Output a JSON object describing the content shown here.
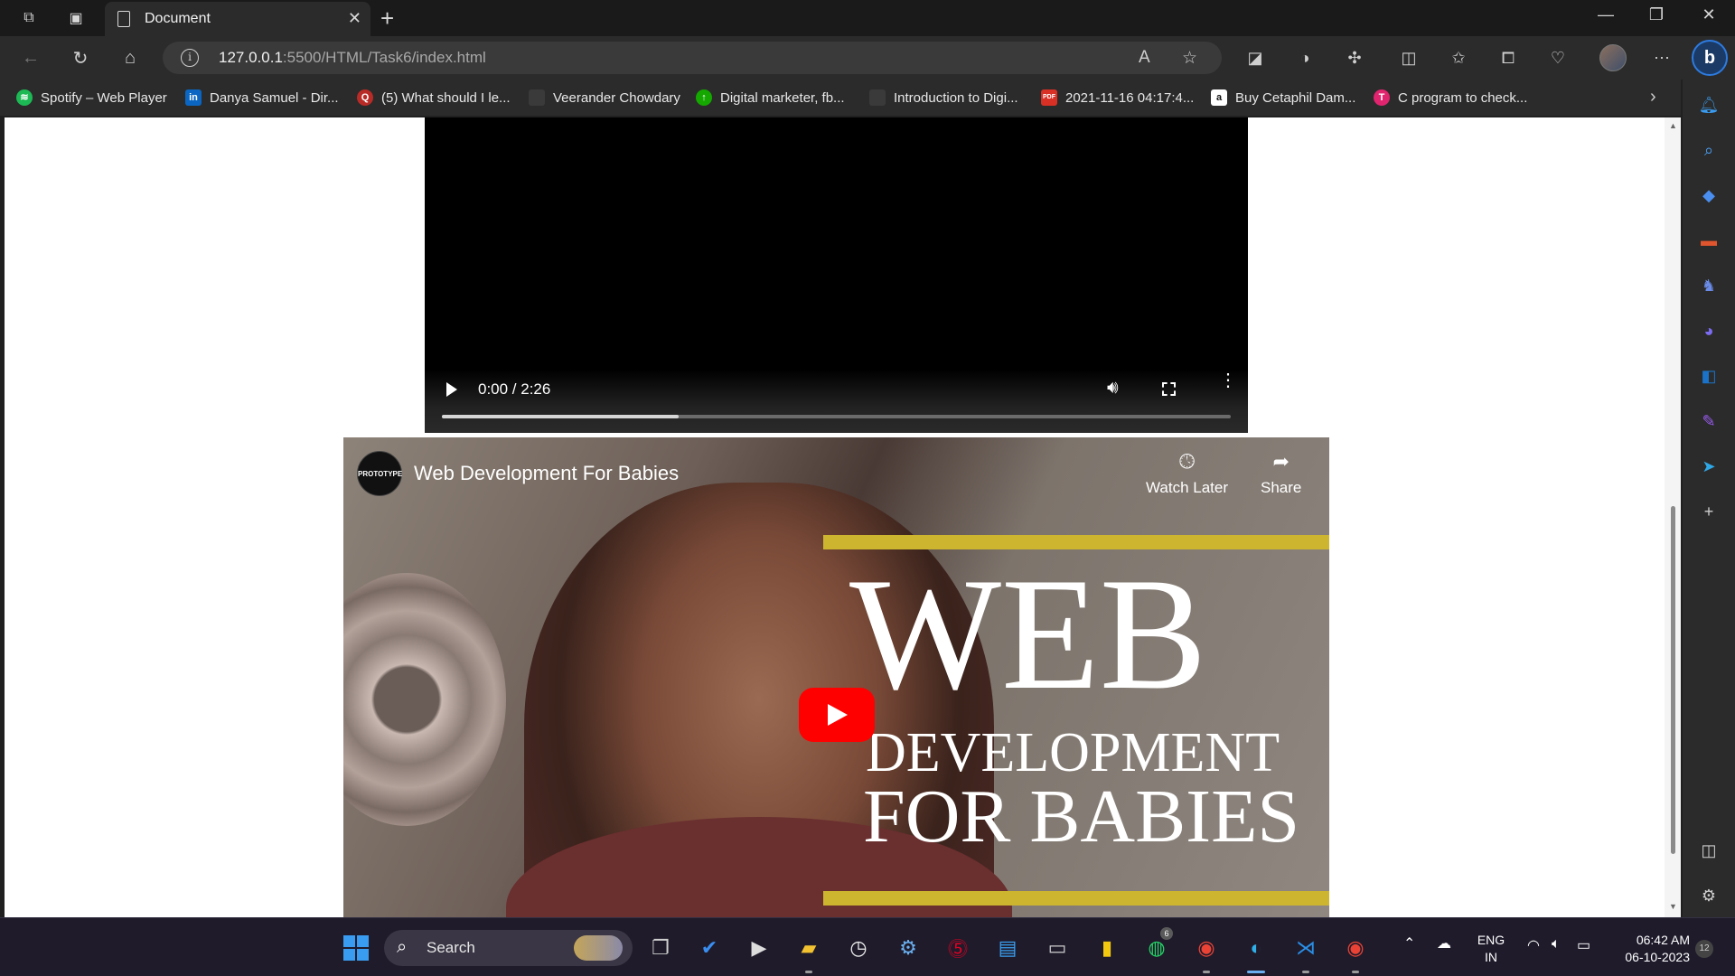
{
  "browser": {
    "tab_title": "Document",
    "url_host": "127.0.0.1",
    "url_path": ":5500/HTML/Task6/index.html"
  },
  "favorites": [
    {
      "label": "Spotify – Web Player",
      "icon": "spotify-icon",
      "color": "#1db954"
    },
    {
      "label": "Danya Samuel - Dir...",
      "icon": "linkedin-icon",
      "color": "#0a66c2"
    },
    {
      "label": "(5) What should I le...",
      "icon": "quora-icon",
      "color": "#b92b27"
    },
    {
      "label": "Veerander Chowdary",
      "icon": "page-icon",
      "color": "#555555"
    },
    {
      "label": "Digital marketer, fb...",
      "icon": "upwork-icon",
      "color": "#14a800"
    },
    {
      "label": "Introduction to Digi...",
      "icon": "page-icon",
      "color": "#555555"
    },
    {
      "label": "2021-11-16 04:17:4...",
      "icon": "pdf-icon",
      "color": "#d93025"
    },
    {
      "label": "Buy Cetaphil Dam...",
      "icon": "amazon-icon",
      "color": "#ffffff"
    },
    {
      "label": "C program to check...",
      "icon": "tpoint-icon",
      "color": "#e0246e"
    }
  ],
  "video": {
    "time": "0:00 / 2:26",
    "buffered_fraction": 0.3
  },
  "youtube": {
    "title": "Web Development For Babies",
    "channel_logo_text": "PROTOTYPE",
    "watch_later": "Watch Later",
    "share": "Share",
    "thumb_line1": "WEB",
    "thumb_line2": "DEVELOPMENT",
    "thumb_line3": "FOR BABIES"
  },
  "taskbar": {
    "search_label": "Search",
    "lang_line1": "ENG",
    "lang_line2": "IN",
    "time": "06:42 AM",
    "date": "06-10-2023",
    "whatsapp_badge": "6",
    "notification_count": "12"
  },
  "colors": {
    "accent": "#2d7be0",
    "yt_red": "#ff0000",
    "stripe": "#cdb52f"
  }
}
